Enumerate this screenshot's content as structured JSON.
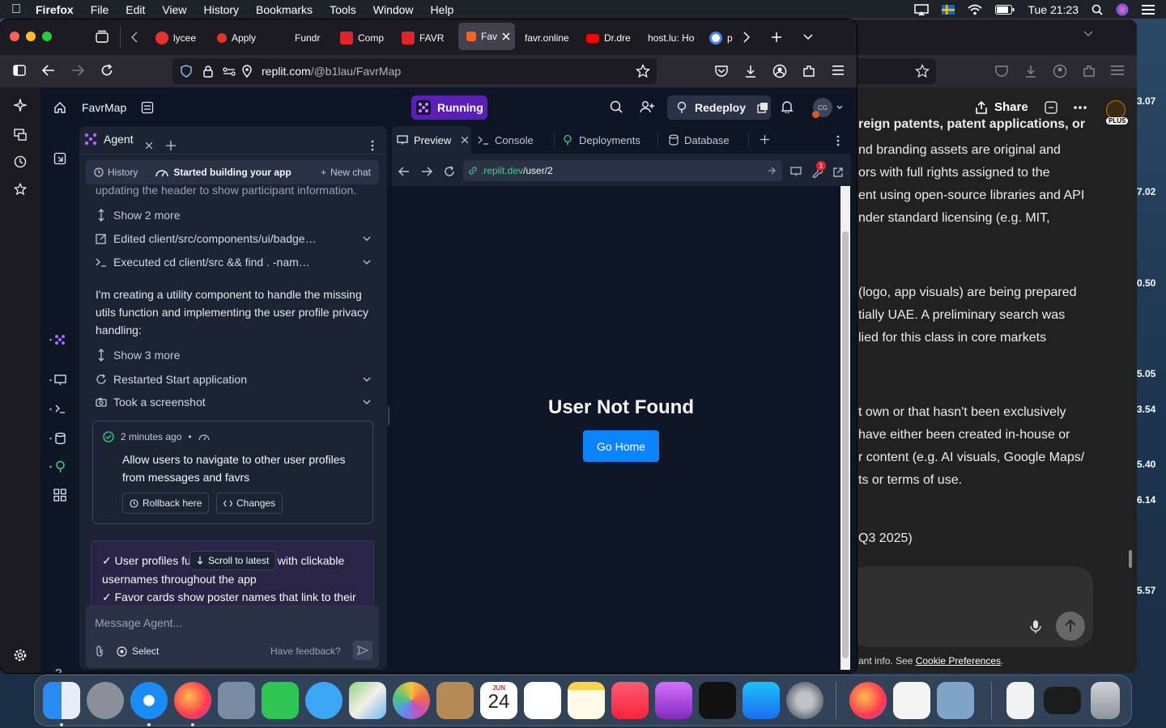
{
  "menubar": {
    "app": "Firefox",
    "items": [
      "File",
      "Edit",
      "View",
      "History",
      "Bookmarks",
      "Tools",
      "Window",
      "Help"
    ],
    "clock": "Tue 21:23"
  },
  "browser": {
    "tabs": [
      {
        "label": "lycee",
        "color": "#e5322d"
      },
      {
        "label": "Apply",
        "color": "#e5322d"
      },
      {
        "label": "Fundr",
        "color": "#1c1b22"
      },
      {
        "label": "Comp",
        "color": "#e2242a"
      },
      {
        "label": "FAVR",
        "color": "#e2242a"
      },
      {
        "label": "Fav",
        "color": "#f26522"
      },
      {
        "label": "favr.online",
        "color": "#1c1b22"
      },
      {
        "label": "Dr.dre",
        "color": "#ff0000"
      },
      {
        "label": "host.lu: Ho",
        "color": "#1c1b22"
      },
      {
        "label": "p",
        "color": "#ffffff"
      }
    ],
    "url_host": "replit.com",
    "url_path": "/@b1lau/FavrMap"
  },
  "replit": {
    "project_name": "FavrMap",
    "run_status": "Running",
    "redeploy_label": "Redeploy",
    "avatar_initials": "CG",
    "accent": "#6b2bd1"
  },
  "agent": {
    "tab_label": "Agent",
    "history_label": "History",
    "building_label": "Started building your app",
    "new_chat_label": "New chat",
    "clipped_line": "updating the header to show participant information.",
    "show_more_1": "Show 2 more",
    "edited_line": "Edited client/src/components/ui/badge…",
    "executed_line": "Executed cd client/src && find . -nam…",
    "message": "I'm creating a utility component to handle the missing utils function and implementing the user profile privacy handling:",
    "show_more_2": "Show 3 more",
    "restarted_line": "Restarted Start application",
    "screenshot_line": "Took a screenshot",
    "checkpoint": {
      "time": "2 minutes ago",
      "text": "Allow users to navigate to other user profiles from messages and favrs",
      "rollback_label": "Rollback here",
      "changes_label": "Changes"
    },
    "summary": {
      "line1a": "✓ User profiles fu",
      "line1b": "with clickable",
      "line2": "usernames throughout the app",
      "line3": "✓ Favor cards show poster names that link to their"
    },
    "scroll_latest": "Scroll to latest",
    "input_placeholder": "Message Agent...",
    "select_label": "Select",
    "feedback_label": "Have feedback?"
  },
  "preview": {
    "tabs": [
      "Preview",
      "Console",
      "Deployments",
      "Database"
    ],
    "url_domain": ".replit.dev",
    "url_path": "/user/2",
    "badge_count": "1",
    "heading": "User Not Found",
    "button": "Go Home"
  },
  "background_window": {
    "share_label": "Share",
    "plus_label": "PLUS",
    "lines": [
      "reign patents, patent applications, or",
      "nd branding assets are original and",
      "ors with full rights assigned to the",
      "ent using open-source libraries and API",
      "nder standard licensing (e.g. MIT,",
      "(logo, app visuals) are being prepared",
      "tially UAE. A preliminary search was",
      "lied for this class in core markets",
      "t own or that hasn't been exclusively",
      "have either been created in-house or",
      "r content (e.g. AI visuals, Google Maps/",
      "ts or terms of use.",
      "Q3 2025)"
    ],
    "footer_prefix": "ant info. See ",
    "footer_link": "Cookie Preferences",
    "footer_suffix": "."
  },
  "stocks": [
    "3.07",
    "7.02",
    "0.50",
    "5.05",
    "3.54",
    "5.40",
    "6.14",
    "5.57"
  ],
  "dock": {
    "calendar_month": "JUN",
    "calendar_day": "24"
  }
}
